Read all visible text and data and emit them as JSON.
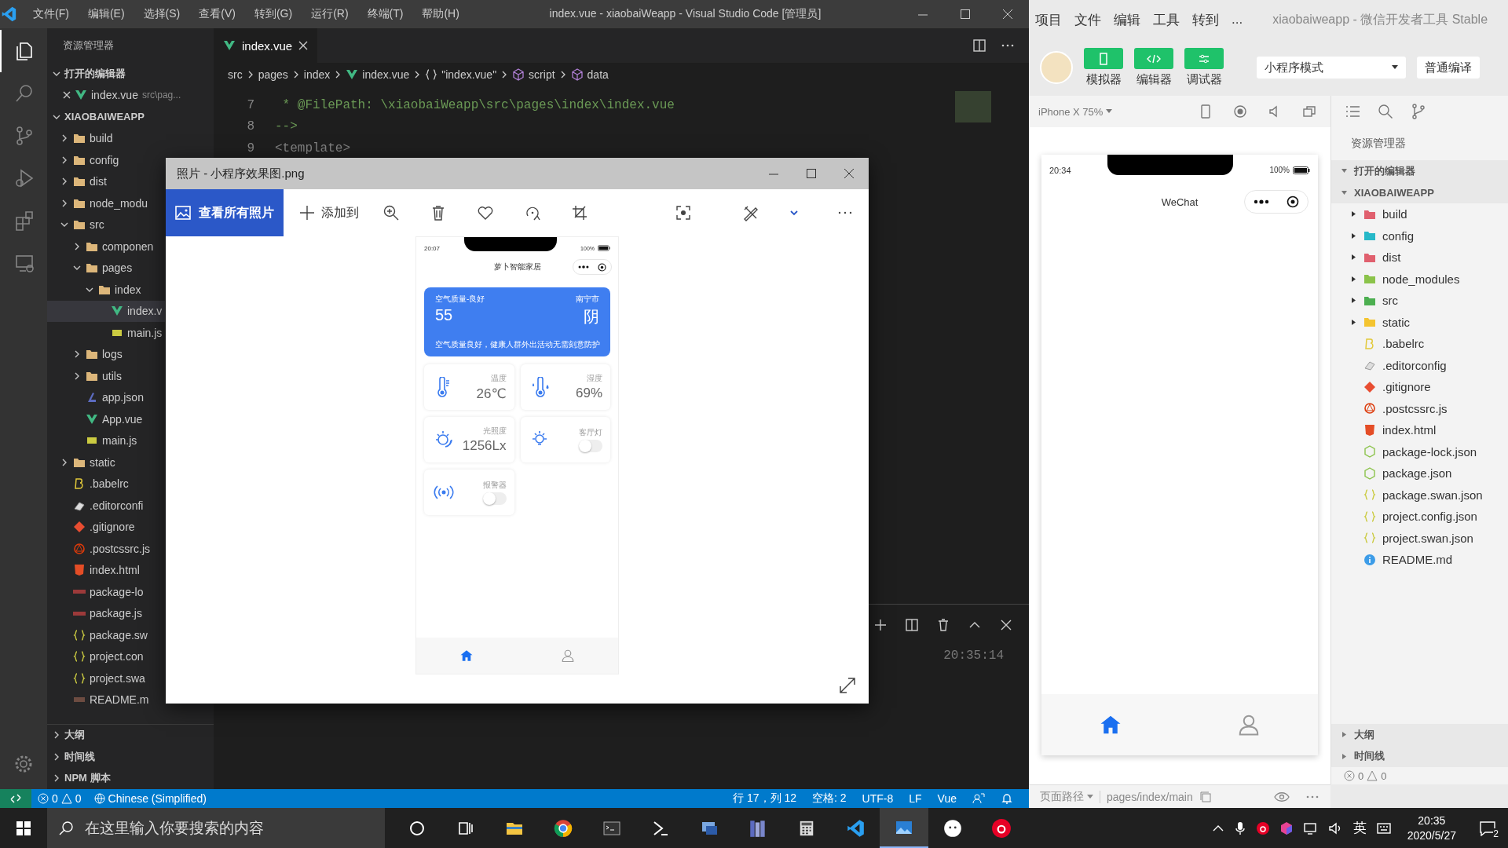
{
  "vscode": {
    "menu": [
      "文件(F)",
      "编辑(E)",
      "选择(S)",
      "查看(V)",
      "转到(G)",
      "运行(R)",
      "终端(T)",
      "帮助(H)"
    ],
    "title": "index.vue - xiaobaiWeapp - Visual Studio Code [管理员]",
    "activity_bar": [
      {
        "kind": "files",
        "selected": true
      },
      {
        "kind": "search",
        "selected": false
      },
      {
        "kind": "source-control",
        "selected": false
      },
      {
        "kind": "debug",
        "selected": false
      },
      {
        "kind": "extensions",
        "selected": false
      },
      {
        "kind": "remote",
        "selected": false
      }
    ],
    "sidebar": {
      "title": "资源管理器",
      "open_editors": {
        "label": "打开的编辑器",
        "expanded": true,
        "items": [
          {
            "name": "index.vue",
            "path": "src\\pag...",
            "kind": "vue"
          }
        ]
      },
      "project": {
        "label": "XIAOBAIWEAPP",
        "expanded": true,
        "children": [
          {
            "name": "build",
            "kind": "folder",
            "expanded": false,
            "selected": false
          },
          {
            "name": "config",
            "kind": "folder",
            "expanded": false,
            "selected": false
          },
          {
            "name": "dist",
            "kind": "folder",
            "expanded": false,
            "selected": false
          },
          {
            "name": "node_modu",
            "kind": "folder",
            "expanded": false,
            "selected": false
          },
          {
            "name": "src",
            "kind": "folder",
            "expanded": true,
            "selected": false,
            "children": [
              {
                "name": "componen",
                "kind": "folder",
                "expanded": false,
                "selected": false
              },
              {
                "name": "pages",
                "kind": "folder",
                "expanded": true,
                "selected": false,
                "children": [
                  {
                    "name": "index",
                    "kind": "folder",
                    "expanded": true,
                    "selected": false,
                    "children": [
                      {
                        "name": "index.v",
                        "kind": "vue",
                        "selected": true
                      },
                      {
                        "name": "main.js",
                        "kind": "js",
                        "selected": false
                      }
                    ]
                  }
                ]
              },
              {
                "name": "logs",
                "kind": "folder",
                "expanded": false,
                "selected": false
              },
              {
                "name": "utils",
                "kind": "folder",
                "expanded": false,
                "selected": false
              },
              {
                "name": "app.json",
                "kind": "json",
                "selected": false
              },
              {
                "name": "App.vue",
                "kind": "vue",
                "selected": false
              },
              {
                "name": "main.js",
                "kind": "js",
                "selected": false
              }
            ]
          },
          {
            "name": "static",
            "kind": "folder",
            "expanded": false,
            "selected": false
          },
          {
            "name": ".babelrc",
            "kind": "babel",
            "selected": false
          },
          {
            "name": ".editorconfi",
            "kind": "config",
            "selected": false
          },
          {
            "name": ".gitignore",
            "kind": "git",
            "selected": false
          },
          {
            "name": ".postcssrc.js",
            "kind": "postcss",
            "selected": false
          },
          {
            "name": "index.html",
            "kind": "html",
            "selected": false
          },
          {
            "name": "package-lo",
            "kind": "npm",
            "selected": false
          },
          {
            "name": "package.js",
            "kind": "npm",
            "selected": false
          },
          {
            "name": "package.sw",
            "kind": "braces",
            "selected": false
          },
          {
            "name": "project.con",
            "kind": "braces",
            "selected": false
          },
          {
            "name": "project.swa",
            "kind": "braces",
            "selected": false
          },
          {
            "name": "README.m",
            "kind": "md",
            "selected": false
          }
        ]
      },
      "sections": [
        {
          "label": "大纲",
          "expanded": false
        },
        {
          "label": "时间线",
          "expanded": false
        },
        {
          "label": "NPM 脚本",
          "expanded": false
        }
      ]
    },
    "tabs": [
      {
        "label": "index.vue",
        "selected": true
      }
    ],
    "breadcrumbs": [
      {
        "label": "src",
        "kind": "plain"
      },
      {
        "label": "pages",
        "kind": "plain"
      },
      {
        "label": "index",
        "kind": "plain"
      },
      {
        "label": "index.vue",
        "kind": "vue"
      },
      {
        "label": "\"index.vue\"",
        "kind": "braces"
      },
      {
        "label": "script",
        "kind": "module"
      },
      {
        "label": "data",
        "kind": "module"
      }
    ],
    "code": [
      {
        "number": "7",
        "kind": "comment",
        "text": " * @FilePath: \\xiaobaiWeapp\\src\\pages\\index\\index.vue"
      },
      {
        "number": "8",
        "kind": "comment",
        "text": "-->"
      },
      {
        "number": "9",
        "kind": "tag",
        "text": "<template>"
      }
    ],
    "panel": {
      "time": "20:35:14"
    },
    "status_bar": {
      "errors": "0",
      "warnings": "0",
      "language": "Chinese (Simplified)",
      "position": "行 17，列 12",
      "spaces": "空格: 2",
      "encoding": "UTF-8",
      "eol": "LF",
      "mode": "Vue"
    }
  },
  "photos": {
    "title": "照片 - 小程序效果图.png",
    "view_all": "查看所有照片",
    "add_to": "添加到",
    "phone": {
      "time": "20:07",
      "battery": "100%",
      "nav_title": "萝卜智能家居",
      "air": {
        "label": "空气质量-良好",
        "value": "55",
        "city": "南宁市",
        "weather": "阴",
        "note": "空气质量良好，健康人群外出活动无需刻意防护"
      },
      "tiles": [
        {
          "kind": "reading",
          "label": "温度",
          "value": "26℃"
        },
        {
          "kind": "reading",
          "label": "湿度",
          "value": "69%"
        },
        {
          "kind": "reading",
          "label": "光照度",
          "value": "1256Lx"
        },
        {
          "kind": "switch",
          "label": "客厅灯",
          "on": false
        },
        {
          "kind": "switch",
          "label": "报警器",
          "on": false
        }
      ],
      "tab_bar": [
        {
          "kind": "home",
          "selected": true
        },
        {
          "kind": "user",
          "selected": false
        }
      ]
    }
  },
  "devtools": {
    "menu": [
      "项目",
      "文件",
      "编辑",
      "工具",
      "转到",
      "..."
    ],
    "title": "xiaobaiweapp - 微信开发者工具 Stable",
    "toolbar": [
      {
        "label": "模拟器",
        "kind": "phone"
      },
      {
        "label": "编辑器",
        "kind": "code"
      },
      {
        "label": "调试器",
        "kind": "sliders"
      }
    ],
    "mode": "小程序模式",
    "compile": "普通编译",
    "device": "iPhone X 75%",
    "simulator": {
      "time": "20:34",
      "battery": "100%",
      "nav_title": "WeChat",
      "tab_bar": [
        {
          "kind": "home",
          "selected": true
        },
        {
          "kind": "user",
          "selected": false
        }
      ]
    },
    "explorer": {
      "title": "资源管理器",
      "sections": [
        {
          "label": "打开的编辑器",
          "expanded": true
        },
        {
          "label": "XIAOBAIWEAPP",
          "expanded": true
        }
      ],
      "files": [
        {
          "name": "build",
          "kind": "folder",
          "color": "#e0606e"
        },
        {
          "name": "config",
          "kind": "folder",
          "color": "#26b8c8"
        },
        {
          "name": "dist",
          "kind": "folder",
          "color": "#e0606e"
        },
        {
          "name": "node_modules",
          "kind": "folder",
          "color": "#8bc34a"
        },
        {
          "name": "src",
          "kind": "folder",
          "color": "#4caf50"
        },
        {
          "name": "static",
          "kind": "folder",
          "color": "#f4c430"
        },
        {
          "name": ".babelrc",
          "kind": "babel"
        },
        {
          "name": ".editorconfig",
          "kind": "config"
        },
        {
          "name": ".gitignore",
          "kind": "git"
        },
        {
          "name": ".postcssrc.js",
          "kind": "postcss"
        },
        {
          "name": "index.html",
          "kind": "html"
        },
        {
          "name": "package-lock.json",
          "kind": "node"
        },
        {
          "name": "package.json",
          "kind": "node"
        },
        {
          "name": "package.swan.json",
          "kind": "braces"
        },
        {
          "name": "project.config.json",
          "kind": "braces"
        },
        {
          "name": "project.swan.json",
          "kind": "braces"
        },
        {
          "name": "README.md",
          "kind": "info"
        }
      ],
      "bottom_sections": [
        {
          "label": "大纲",
          "expanded": false
        },
        {
          "label": "时间线",
          "expanded": false
        }
      ],
      "errors": "0",
      "warnings": "0"
    },
    "footer": {
      "label": "页面路径",
      "path": "pages/index/main"
    }
  },
  "taskbar": {
    "search_placeholder": "在这里输入你要搜索的内容",
    "apps": [
      {
        "kind": "cortana",
        "selected": false
      },
      {
        "kind": "task-view",
        "selected": false
      },
      {
        "kind": "folder",
        "selected": false
      },
      {
        "kind": "browser",
        "selected": false
      },
      {
        "kind": "terminal",
        "selected": false
      },
      {
        "kind": "prompt",
        "selected": false
      },
      {
        "kind": "remote",
        "selected": false
      },
      {
        "kind": "books",
        "selected": false
      },
      {
        "kind": "calculator",
        "selected": false
      },
      {
        "kind": "editor",
        "selected": false
      },
      {
        "kind": "photos",
        "selected": true
      },
      {
        "kind": "chat",
        "selected": false
      },
      {
        "kind": "music",
        "selected": false
      }
    ],
    "ime": "英",
    "time": "20:35",
    "date": "2020/5/27",
    "notifications": "2"
  }
}
